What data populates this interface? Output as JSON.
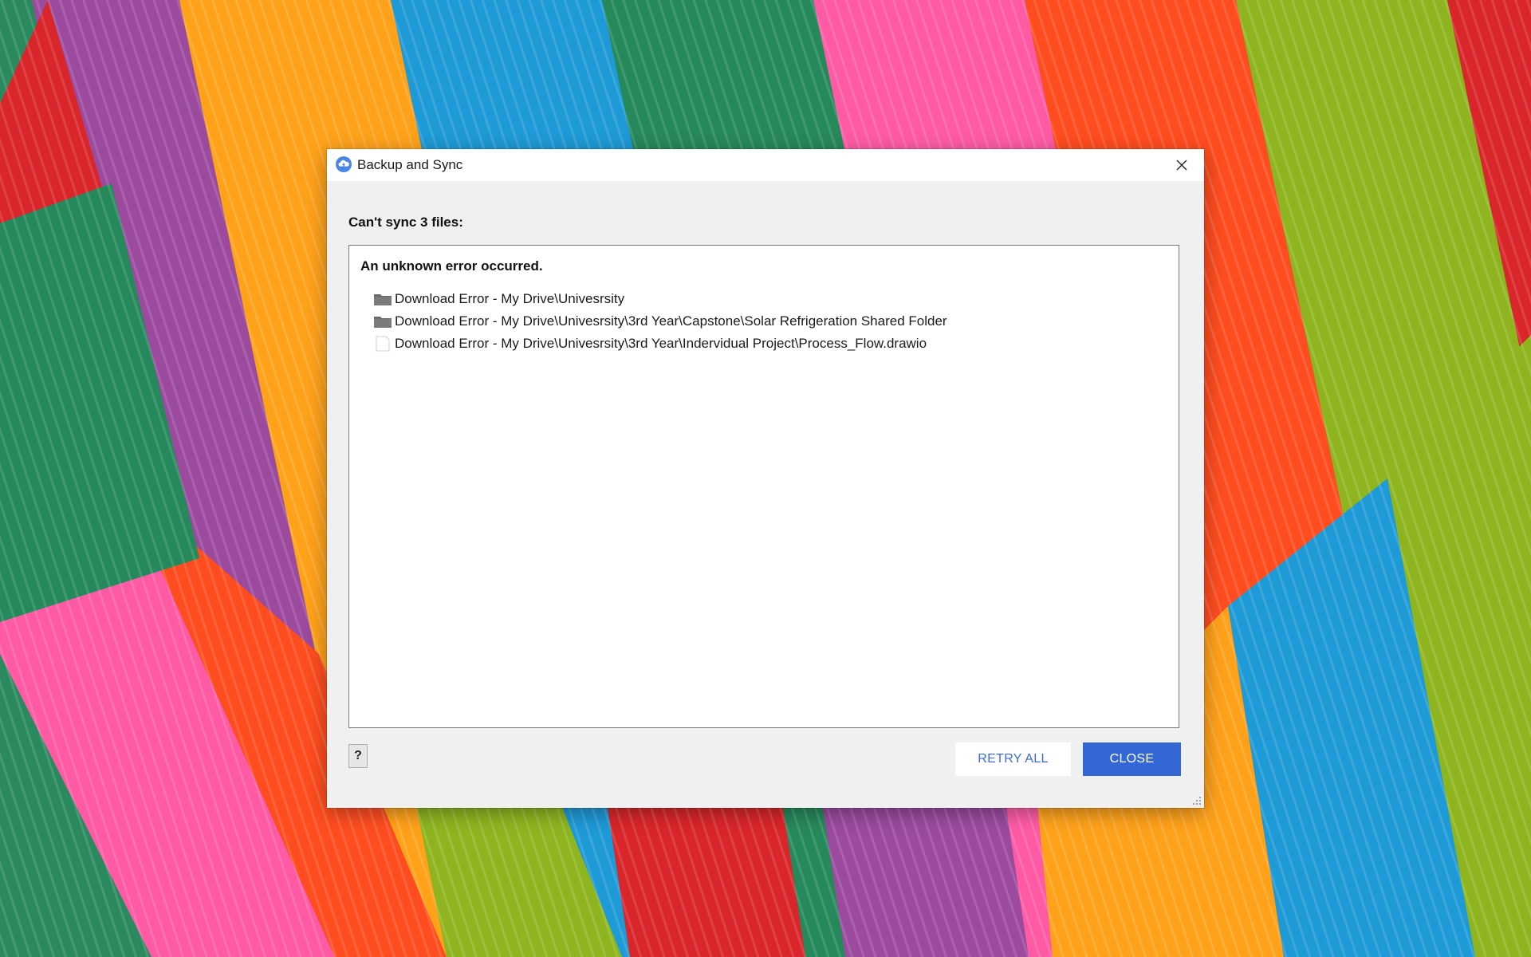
{
  "window": {
    "title": "Backup and Sync"
  },
  "dialog": {
    "heading": "Can't sync 3 files:",
    "error_title": "An unknown error occurred.",
    "items": [
      {
        "icon": "folder-icon",
        "text": "Download Error - My Drive\\Univesrsity"
      },
      {
        "icon": "folder-icon",
        "text": "Download Error - My Drive\\Univesrsity\\3rd Year\\Capstone\\Solar Refrigeration Shared Folder"
      },
      {
        "icon": "file-icon",
        "text": "Download Error - My Drive\\Univesrsity\\3rd Year\\Indervidual Project\\Process_Flow.drawio"
      }
    ]
  },
  "buttons": {
    "help_label": "?",
    "retry_label": "RETRY ALL",
    "close_label": "CLOSE"
  },
  "colors": {
    "primary": "#3367d6",
    "dialog_bg": "#f0f0f0",
    "wallpaper": [
      "#2a8a5e",
      "#9b4a9e",
      "#ff5ba5",
      "#ffa21a",
      "#ff4d1f",
      "#1e9ad6",
      "#8eb51f",
      "#d9262a"
    ]
  }
}
